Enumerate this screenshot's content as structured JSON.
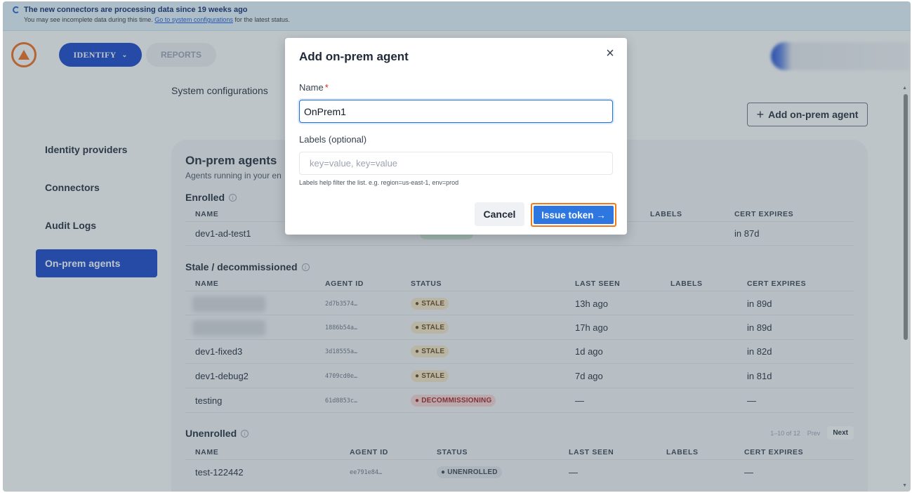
{
  "banner": {
    "title": "The new connectors are processing data since 19 weeks ago",
    "message": "You may see incomplete data during this time.",
    "link": "Go to system configurations",
    "suffix": "for the latest status."
  },
  "nav": {
    "identify": "IDENTIFY",
    "reports": "REPORTS"
  },
  "breadcrumb": "System configurations",
  "add_agent_button": "Add on-prem agent",
  "sidebar": {
    "items": [
      {
        "label": "Identity providers"
      },
      {
        "label": "Connectors"
      },
      {
        "label": "Audit Logs"
      },
      {
        "label": "On-prem agents"
      }
    ]
  },
  "card": {
    "title": "On-prem agents",
    "subtitle": "Agents running in your en",
    "enrolled": {
      "title": "Enrolled",
      "headers": [
        "NAME",
        "LABELS",
        "CERT EXPIRES"
      ],
      "rows": [
        {
          "name": "dev1-ad-test1",
          "cert": "in 87d"
        }
      ]
    },
    "stale": {
      "title": "Stale / decommissioned",
      "headers": [
        "NAME",
        "AGENT ID",
        "STATUS",
        "LAST SEEN",
        "LABELS",
        "CERT EXPIRES"
      ],
      "rows": [
        {
          "name": "",
          "id": "2d7b3574…",
          "status": "● STALE",
          "seen": "13h ago",
          "cert": "in 89d"
        },
        {
          "name": "",
          "id": "1886b54a…",
          "status": "● STALE",
          "seen": "17h ago",
          "cert": "in 89d"
        },
        {
          "name": "dev1-fixed3",
          "id": "3d18555a…",
          "status": "● STALE",
          "seen": "1d ago",
          "cert": "in 82d"
        },
        {
          "name": "dev1-debug2",
          "id": "4709cd0e…",
          "status": "● STALE",
          "seen": "7d ago",
          "cert": "in 81d"
        },
        {
          "name": "testing",
          "id": "61d8853c…",
          "status": "● DECOMMISSIONING",
          "seen": "—",
          "cert": "—"
        }
      ]
    },
    "unenrolled": {
      "title": "Unenrolled",
      "pager": {
        "range": "1–10 of 12",
        "prev": "Prev",
        "next": "Next"
      },
      "headers": [
        "NAME",
        "AGENT ID",
        "STATUS",
        "LAST SEEN",
        "LABELS",
        "CERT EXPIRES"
      ],
      "rows": [
        {
          "name": "test-122442",
          "id": "ee791e84…",
          "status": "● UNENROLLED",
          "seen": "—",
          "cert": "—"
        }
      ]
    }
  },
  "modal": {
    "title": "Add on-prem agent",
    "close": "×",
    "name_label": "Name",
    "required_mark": "*",
    "name_value": "OnPrem1",
    "labels_label": "Labels (optional)",
    "labels_placeholder": "key=value, key=value",
    "labels_value": "",
    "hint": "Labels help filter the list. e.g. region=us-east-1, env=prod",
    "cancel": "Cancel",
    "issue": "Issue token →"
  },
  "colors": {
    "primary": "#1444c9",
    "accent_button": "#2f77e0",
    "focus_outline": "#f27a1a",
    "logo": "#f26a1b"
  }
}
